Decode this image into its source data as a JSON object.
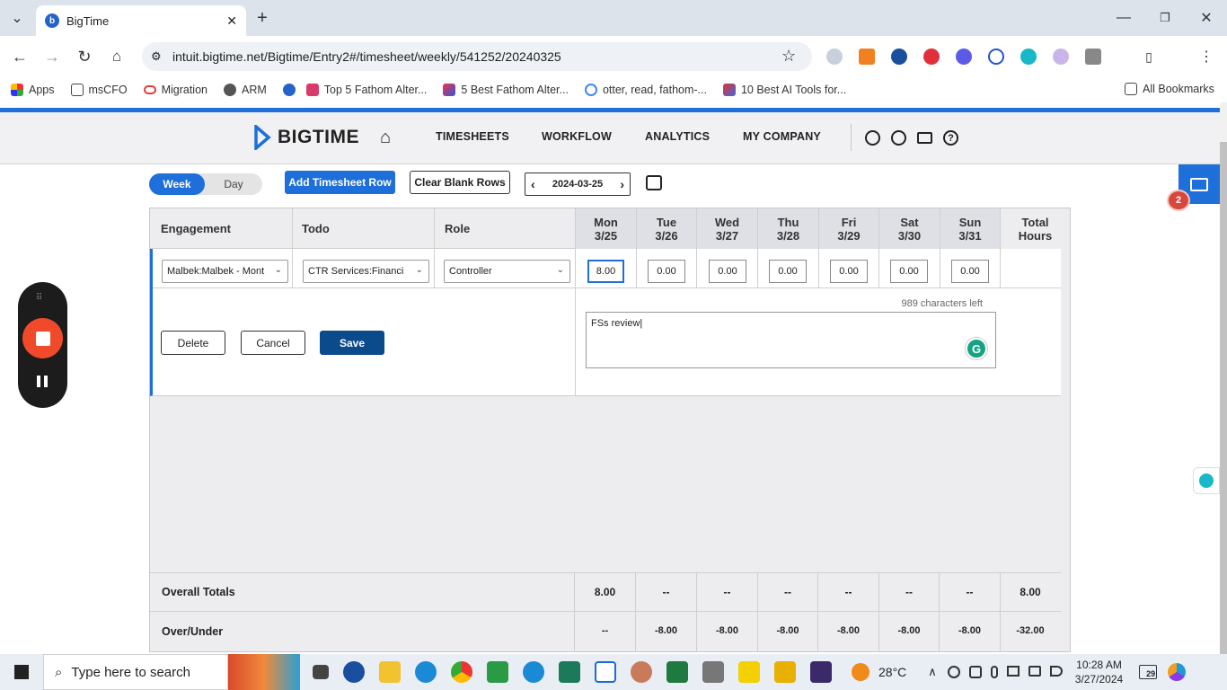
{
  "browser": {
    "tab_title": "BigTime",
    "url": "intuit.bigtime.net/Bigtime/Entry2#/timesheet/weekly/541252/20240325",
    "bookmarks": [
      "Apps",
      "msCFO",
      "Migration",
      "ARM",
      "Top 5 Fathom Alter...",
      "5 Best Fathom Alter...",
      "otter, read, fathom-...",
      "10 Best AI Tools for..."
    ],
    "all_bookmarks": "All Bookmarks"
  },
  "app": {
    "logo": "BIGTIME",
    "nav": [
      "TIMESHEETS",
      "WORKFLOW",
      "ANALYTICS",
      "MY COMPANY"
    ]
  },
  "toolbar": {
    "week": "Week",
    "day": "Day",
    "add_row": "Add Timesheet Row",
    "clear_blank": "Clear Blank Rows",
    "date": "2024-03-25"
  },
  "grid": {
    "headers": {
      "engagement": "Engagement",
      "todo": "Todo",
      "role": "Role",
      "total_line1": "Total",
      "total_line2": "Hours"
    },
    "days": [
      {
        "name": "Mon",
        "date": "3/25"
      },
      {
        "name": "Tue",
        "date": "3/26"
      },
      {
        "name": "Wed",
        "date": "3/27"
      },
      {
        "name": "Thu",
        "date": "3/28"
      },
      {
        "name": "Fri",
        "date": "3/29"
      },
      {
        "name": "Sat",
        "date": "3/30"
      },
      {
        "name": "Sun",
        "date": "3/31"
      }
    ],
    "row": {
      "engagement": "Malbek:Malbek - Mont",
      "todo": "CTR Services:Financi",
      "role": "Controller",
      "hours": [
        "8.00",
        "0.00",
        "0.00",
        "0.00",
        "0.00",
        "0.00",
        "0.00"
      ]
    },
    "notes": {
      "chars_left": "989 characters left",
      "text": "FSs review"
    },
    "buttons": {
      "delete": "Delete",
      "cancel": "Cancel",
      "save": "Save"
    },
    "overall": {
      "label": "Overall Totals",
      "values": [
        "8.00",
        "--",
        "--",
        "--",
        "--",
        "--",
        "--"
      ],
      "total": "8.00"
    },
    "overunder": {
      "label": "Over/Under",
      "values": [
        "--",
        "-8.00",
        "-8.00",
        "-8.00",
        "-8.00",
        "-8.00",
        "-8.00"
      ],
      "total": "-32.00"
    }
  },
  "chat_badge": "2",
  "taskbar": {
    "search": "Type here to search",
    "weather": "28°C",
    "time": "10:28 AM",
    "date": "3/27/2024",
    "notif": "29"
  },
  "colors": {
    "brand_blue": "#1e6fd9",
    "save_blue": "#0b4a8b",
    "badge_red": "#d9473a"
  }
}
